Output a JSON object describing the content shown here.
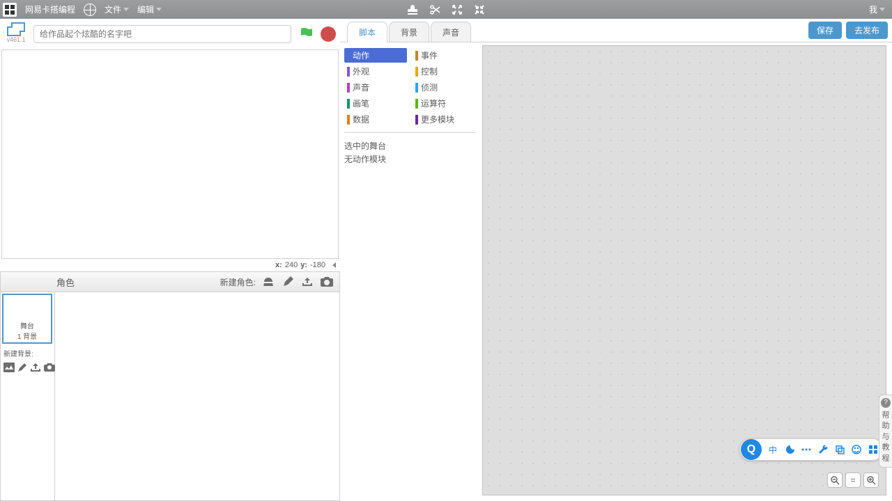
{
  "topbar": {
    "app_name": "网易卡搭编程",
    "menu_file": "文件",
    "menu_edit": "编辑",
    "menu_me": "我"
  },
  "stage_header": {
    "version": "v461.1",
    "project_name_placeholder": "给作品起个炫酷的名字吧"
  },
  "coords": {
    "x_label": "x:",
    "x_value": "240",
    "y_label": "y:",
    "y_value": "-180"
  },
  "sprites_bar": {
    "sprites_label": "角色",
    "new_sprite_label": "新建角色:"
  },
  "stage_panel": {
    "stage_label": "舞台",
    "bg_count": "1 背景",
    "new_bg_label": "新建背景:"
  },
  "tabs": {
    "scripts": "脚本",
    "backdrops": "背景",
    "sounds": "声音"
  },
  "buttons": {
    "save": "保存",
    "publish": "去发布"
  },
  "categories": [
    {
      "name": "动作",
      "color": "#4a6cd4",
      "active": true
    },
    {
      "name": "事件",
      "color": "#c88330"
    },
    {
      "name": "外观",
      "color": "#8a55d7"
    },
    {
      "name": "控制",
      "color": "#e1a91a"
    },
    {
      "name": "声音",
      "color": "#bb42c3"
    },
    {
      "name": "侦测",
      "color": "#2ca5e2"
    },
    {
      "name": "画笔",
      "color": "#0e9a6c"
    },
    {
      "name": "运算符",
      "color": "#5cb712"
    },
    {
      "name": "数据",
      "color": "#ee7d16"
    },
    {
      "name": "更多模块",
      "color": "#632d99"
    }
  ],
  "palette_msg": {
    "line1": "选中的舞台",
    "line2": "无动作模块"
  },
  "float_toolbar": {
    "circle": "Q",
    "lang": "中"
  },
  "help_tab": {
    "text": "帮助与教程"
  }
}
